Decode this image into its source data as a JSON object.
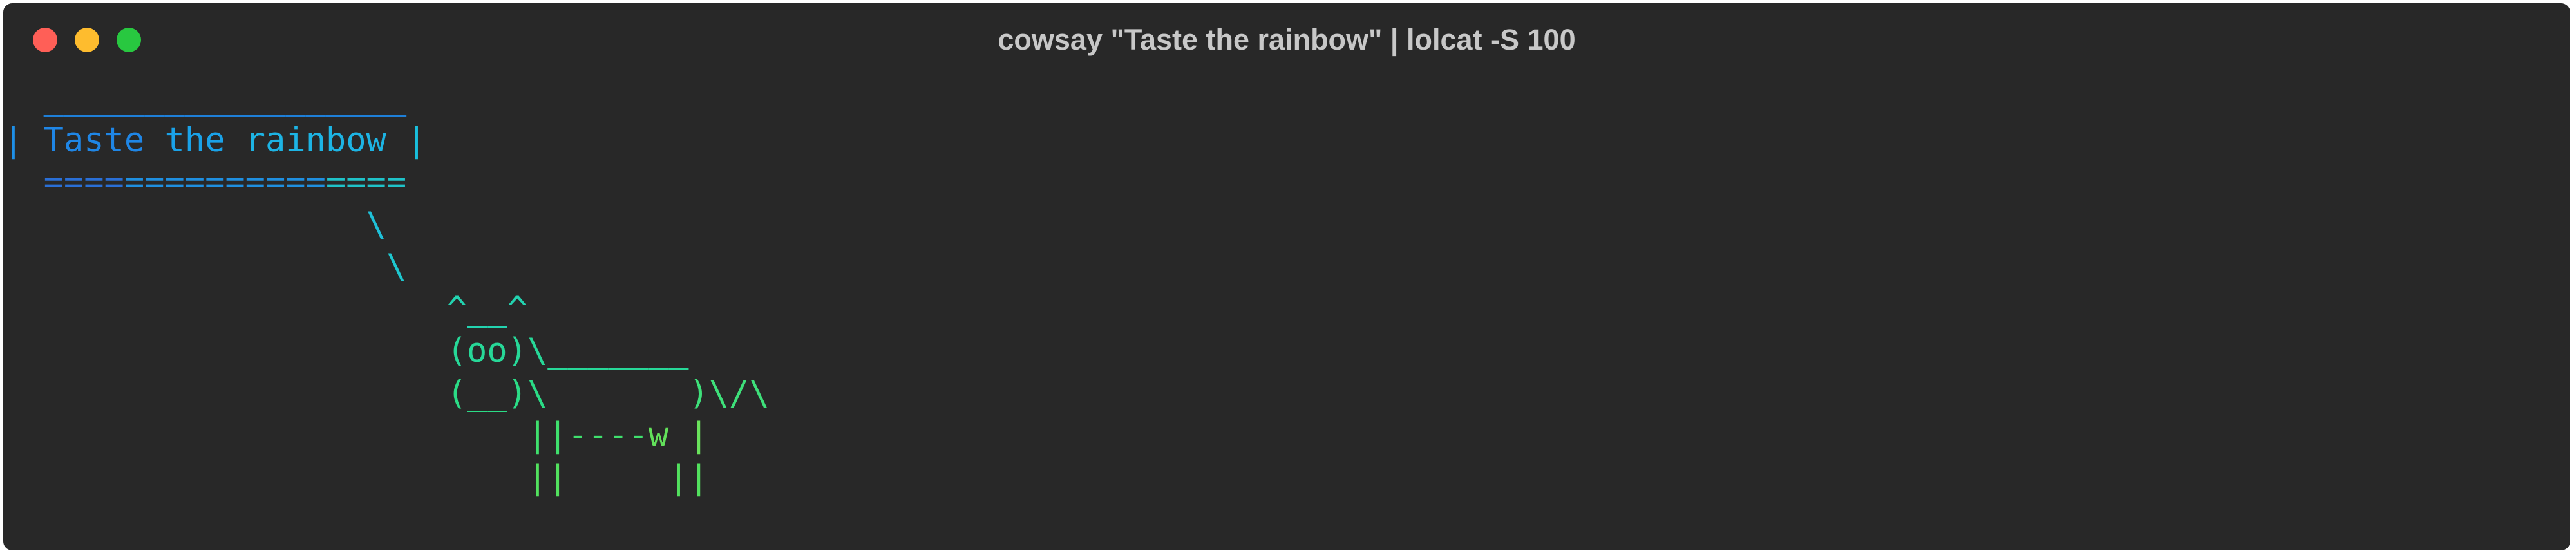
{
  "window": {
    "title": "cowsay \"Taste the rainbow\" | lolcat -S 100",
    "controls": [
      "close-icon",
      "minimize-icon",
      "zoom-icon"
    ]
  },
  "terminal": {
    "lines": [
      {
        "segments": [
          {
            "text": "  __________________ ",
            "color": "#1e7fd8"
          }
        ]
      },
      {
        "segments": [
          {
            "text": "| ",
            "color": "#1e90e8"
          },
          {
            "text": "Taste ",
            "color": "#1f86e6"
          },
          {
            "text": "the ",
            "color": "#1aa2e8"
          },
          {
            "text": "rainbow",
            "color": "#1db4e4"
          },
          {
            "text": " |",
            "color": "#19bfdc"
          }
        ]
      },
      {
        "segments": [
          {
            "text": "  ====",
            "color": "#2a6fd6"
          },
          {
            "text": "==========",
            "color": "#1f8fe0"
          },
          {
            "text": "====",
            "color": "#1fc2c8"
          }
        ]
      },
      {
        "segments": [
          {
            "text": "                  \\",
            "color": "#1fc0d8"
          }
        ]
      },
      {
        "segments": [
          {
            "text": "                   \\",
            "color": "#1ec7cf"
          }
        ]
      },
      {
        "segments": [
          {
            "text": "                      ^__^",
            "color": "#23d3b0"
          }
        ]
      },
      {
        "segments": [
          {
            "text": "                      (oo)\\_______",
            "color": "#27d898"
          }
        ]
      },
      {
        "segments": [
          {
            "text": "                      (__)\\       ",
            "color": "#2bdc86"
          },
          {
            "text": ")\\/\\",
            "color": "#3ee07a"
          }
        ]
      },
      {
        "segments": [
          {
            "text": "                          ||----",
            "color": "#3fe06d"
          },
          {
            "text": "w",
            "color": "#62e05a"
          },
          {
            "text": " |",
            "color": "#6ae35c"
          }
        ]
      },
      {
        "segments": [
          {
            "text": "                          ||     ||",
            "color": "#52e15e"
          }
        ]
      }
    ]
  }
}
